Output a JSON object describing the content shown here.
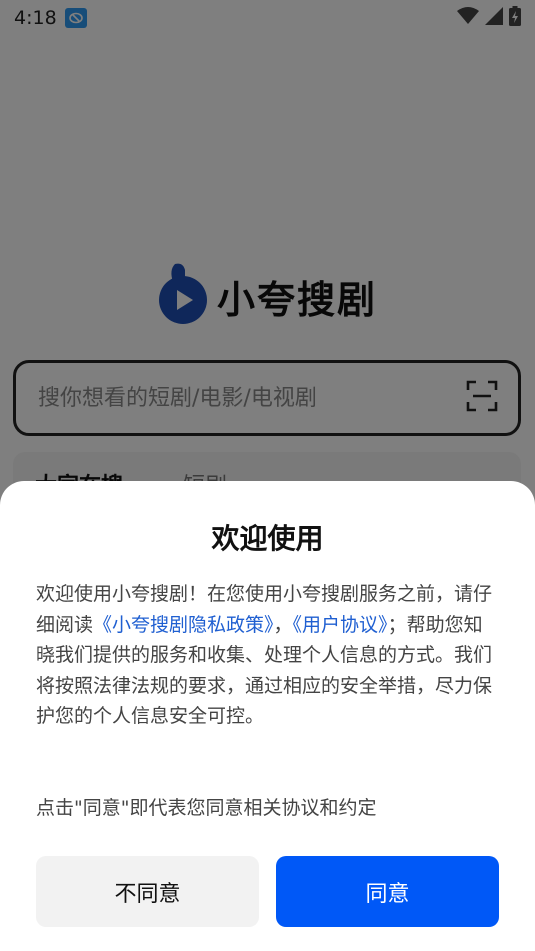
{
  "status_bar": {
    "time": "4:18",
    "notification_icon": "nfc-app-icon",
    "icons": [
      "wifi-icon",
      "cellular-signal-icon",
      "battery-charging-icon"
    ]
  },
  "app": {
    "name": "小夸搜剧",
    "brand_color": "#1f4fb5",
    "search": {
      "placeholder": "搜你想看的短剧/电影/电视剧"
    },
    "hot_tabs": [
      {
        "label": "大家在搜"
      },
      {
        "label": "短剧"
      }
    ]
  },
  "dialog": {
    "title": "欢迎使用",
    "body_part1": "欢迎使用小夸搜剧！在您使用小夸搜剧服务之前，请仔细阅读",
    "privacy_link": "《小夸搜剧隐私政策》",
    "separator": "，",
    "user_agreement_link": "《用户协议》",
    "body_part2": "；帮助您知晓我们提供的服务和收集、处理个人信息的方式。我们将按照法律法规的要求，通过相应的安全举措，尽力保护您的个人信息安全可控。",
    "note": "点击\"同意\"即代表您同意相关协议和约定",
    "decline_label": "不同意",
    "agree_label": "同意",
    "agree_color": "#0058f7",
    "link_color": "#1f5fd1"
  }
}
